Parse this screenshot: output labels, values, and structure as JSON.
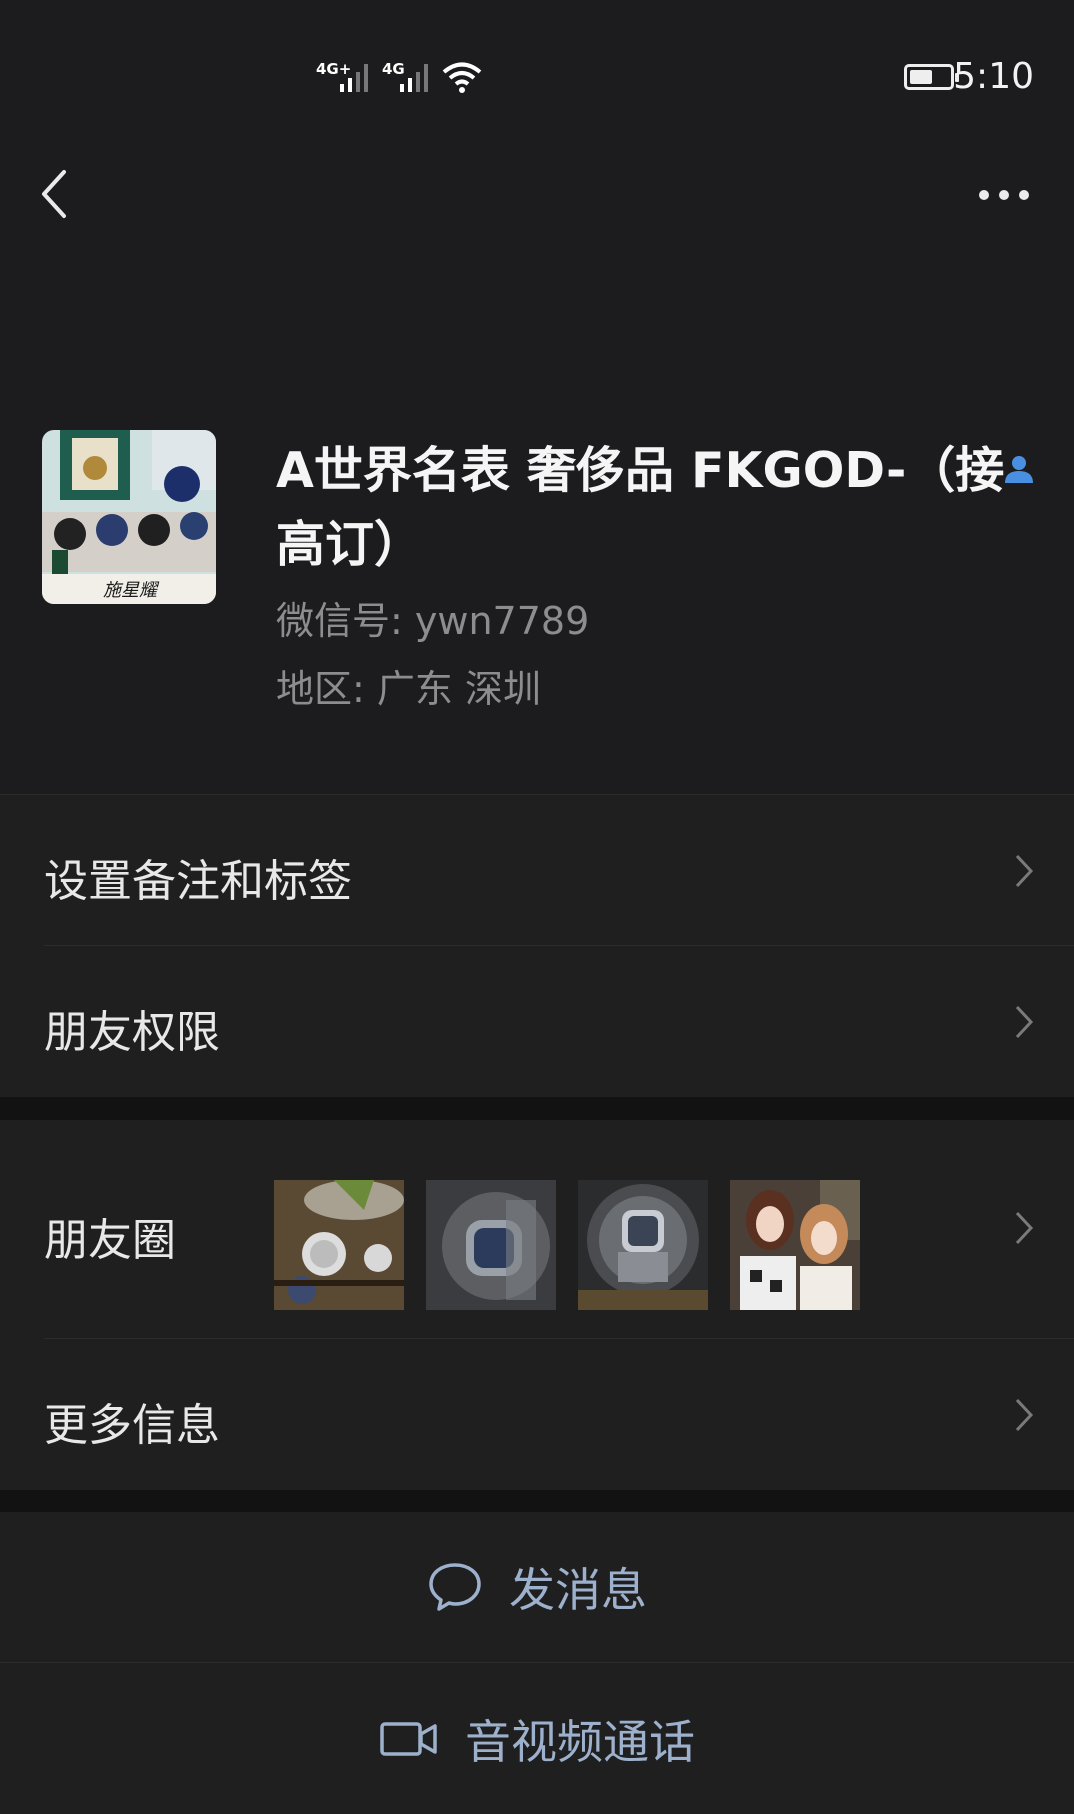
{
  "status_bar": {
    "network_1": "4G+",
    "network_2": "4G",
    "time": "5:10"
  },
  "nav": {
    "back_icon": "chevron-left-icon",
    "more_icon": "more-dots-icon"
  },
  "profile": {
    "nickname": "A世界名表 奢侈品 FKGOD-（接高订）",
    "wechat_id": "微信号:  ywn7789",
    "region": "地区:  广东  深圳",
    "avatar_caption": "施星耀",
    "verify_icon": "person-icon"
  },
  "cells": {
    "remark_label": "设置备注和标签",
    "permissions_label": "朋友权限",
    "moments_label": "朋友圈",
    "more_info_label": "更多信息"
  },
  "actions": {
    "message_label": "发消息",
    "message_icon": "chat-bubble-icon",
    "call_label": "音视频通话",
    "call_icon": "video-camera-icon"
  },
  "colors": {
    "background": "#1c1c1e",
    "cell": "#1f1f1f",
    "section_gap": "#121212",
    "action_text": "#9db0cc",
    "secondary_text": "#8d8d8d",
    "verify_blue": "#4a90e2"
  }
}
